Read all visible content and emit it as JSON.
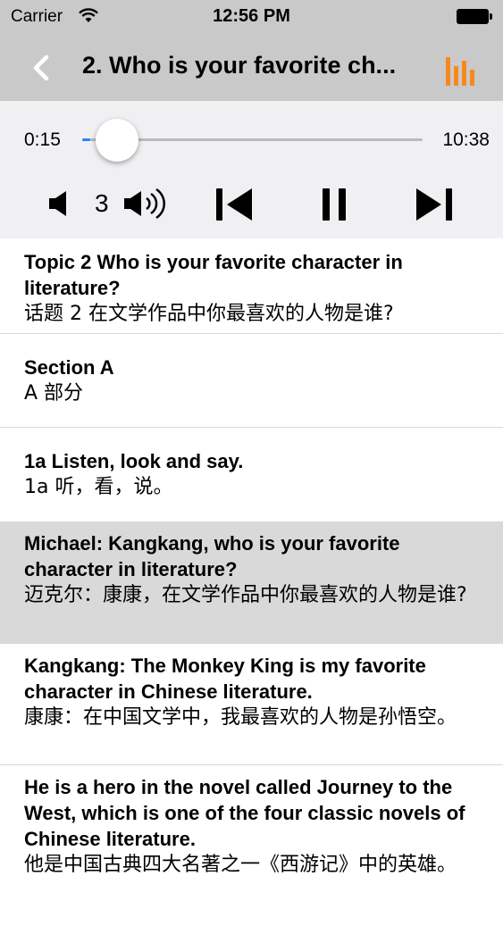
{
  "status_bar": {
    "carrier": "Carrier",
    "time": "12:56 PM"
  },
  "nav": {
    "title": "2. Who is your favorite ch..."
  },
  "player": {
    "current_time": "0:15",
    "total_time": "10:38",
    "progress": 0.024,
    "volume_level": "3"
  },
  "content": [
    {
      "en": "Topic 2 Who is your favorite character in literature?",
      "zh": "话题 2 在文学作品中你最喜欢的人物是谁?"
    },
    {
      "en": "Section A",
      "zh": "A 部分"
    },
    {
      "en": "1a Listen, look and say.",
      "zh": "1a 听，看，说。"
    },
    {
      "en": "Michael: Kangkang, who is your favorite character in literature?",
      "zh": "迈克尔：康康，在文学作品中你最喜欢的人物是谁?"
    },
    {
      "en": "Kangkang: The Monkey King is my favorite character in Chinese literature.",
      "zh": "康康：在中国文学中，我最喜欢的人物是孙悟空。"
    },
    {
      "en": "He is a hero in the novel called Journey to the West, which is one of the four classic novels of Chinese literature.",
      "zh": "他是中国古典四大名著之一《西游记》中的英雄。"
    }
  ],
  "colors": {
    "accent": "#f5891f",
    "bar_bg": "#c9c9c9",
    "progress": "#1e88ff",
    "highlight": "#d9d9d9"
  },
  "icons": [
    "wifi-icon",
    "battery-icon",
    "back-chevron-icon",
    "bar-chart-icon",
    "volume-down-icon",
    "volume-up-icon",
    "skip-previous-icon",
    "pause-icon",
    "skip-next-icon"
  ]
}
